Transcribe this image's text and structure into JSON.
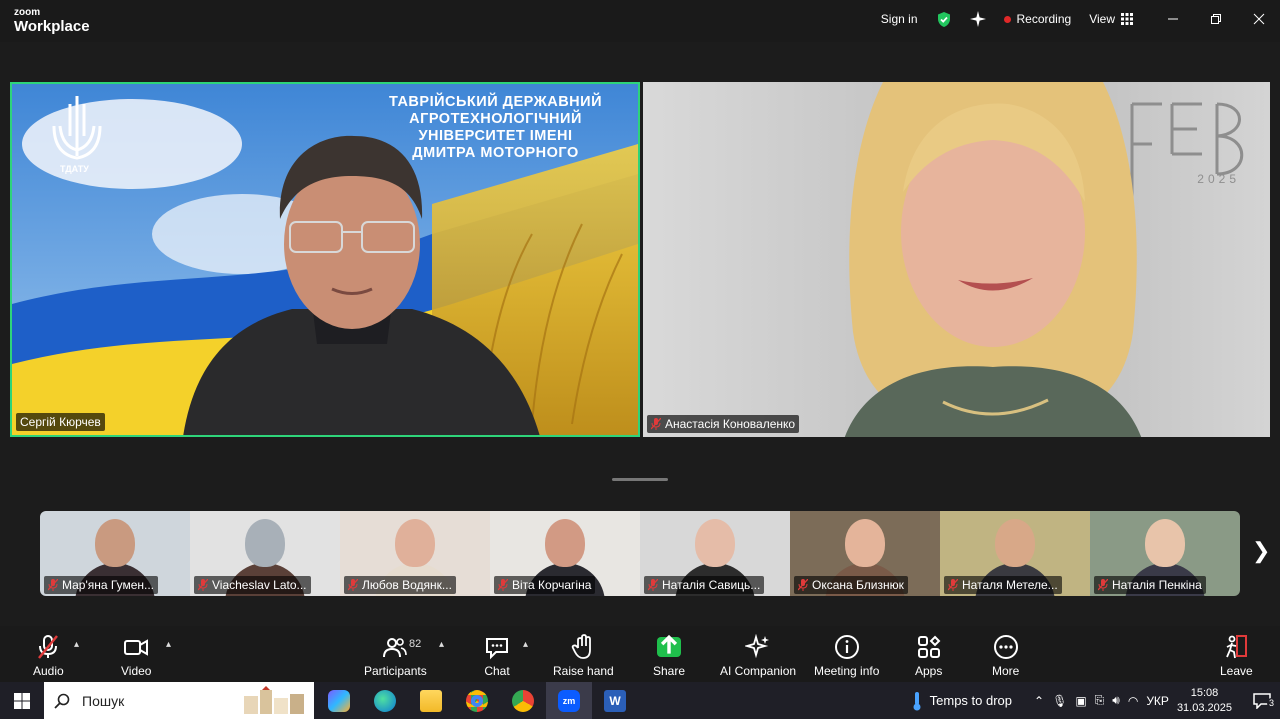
{
  "app": {
    "brand_small": "zoom",
    "brand_large": "Workplace"
  },
  "titlebar": {
    "sign_in": "Sign in",
    "recording": "Recording",
    "view": "View"
  },
  "speaker": {
    "name": "Сергій Кюрчев",
    "banner_lines": [
      "ТАВРІЙСЬКИЙ ДЕРЖАВНИЙ",
      "АГРОТЕХНОЛОГІЧНИЙ",
      "УНІВЕРСИТЕТ ІМЕНІ",
      "ДМИТРА МОТОРНОГО"
    ],
    "logo_label": "ТДАТУ"
  },
  "second": {
    "name": "Анастасія Коноваленко",
    "deco_year": "2025"
  },
  "thumbnails": [
    {
      "name": "Мар'яна  Гумен...",
      "bg": "#cfd6dc",
      "skin": "#c99a80",
      "shirt": "#3a2f33"
    },
    {
      "name": "Viacheslav Lato...",
      "bg": "#e2e2e2",
      "skin": "#a8b0b8",
      "shirt": "#5a4038"
    },
    {
      "name": "Любов Водянк...",
      "bg": "#e6ddd6",
      "skin": "#e0b09a",
      "shirt": "#e6dccf"
    },
    {
      "name": "Віта Корчагіна",
      "bg": "#e8e6e2",
      "skin": "#d29a84",
      "shirt": "#2a2a30"
    },
    {
      "name": "Наталія Савиць...",
      "bg": "#d8d8d8",
      "skin": "#e5bca8",
      "shirt": "#2c2c2c"
    },
    {
      "name": "Оксана Близнюк",
      "bg": "#7c6c58",
      "skin": "#e4b49a",
      "shirt": "#7a5a48"
    },
    {
      "name": "Наталя Метеле...",
      "bg": "#c0b482",
      "skin": "#d8a888",
      "shirt": "#3a3a40"
    },
    {
      "name": "Наталія Пенкіна",
      "bg": "#8a9a86",
      "skin": "#e8c4aa",
      "shirt": "#3a3a48"
    }
  ],
  "toolbar": {
    "audio": "Audio",
    "video": "Video",
    "participants": "Participants",
    "participants_count": "82",
    "chat": "Chat",
    "raise_hand": "Raise hand",
    "share": "Share",
    "ai_companion": "AI Companion",
    "meeting_info": "Meeting info",
    "apps": "Apps",
    "more": "More",
    "leave": "Leave"
  },
  "taskbar": {
    "search_placeholder": "Пошук",
    "weather": "Temps to drop",
    "language": "УКР",
    "time": "15:08",
    "date": "31.03.2025",
    "notifications": "3"
  }
}
